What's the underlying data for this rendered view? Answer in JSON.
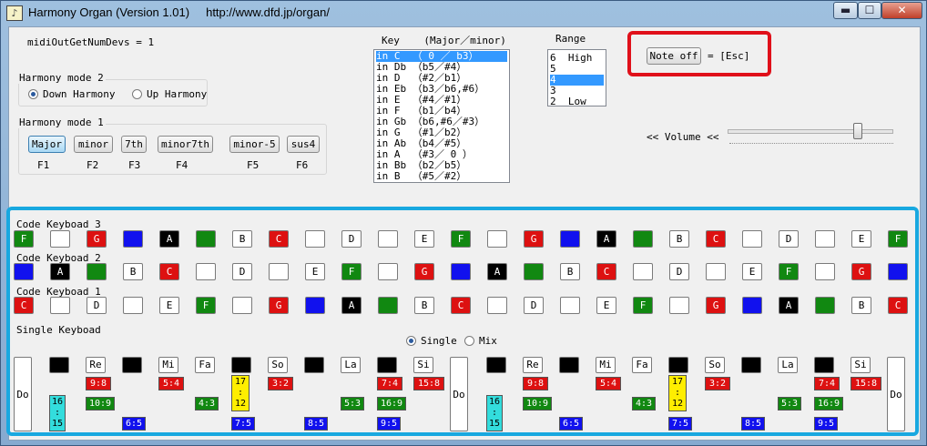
{
  "window": {
    "title": "Harmony Organ (Version 1.01)     http://www.dfd.jp/organ/",
    "min": "▬",
    "max": "☐",
    "close": "✕"
  },
  "midi_label": "midiOutGetNumDevs = 1",
  "harmony_mode2": {
    "title": "Harmony mode 2",
    "down": "Down Harmony",
    "up": "Up Harmony"
  },
  "harmony_mode1": {
    "title": "Harmony mode 1",
    "buttons": [
      "Major",
      "minor",
      "7th",
      "minor7th",
      "minor-5",
      "sus4"
    ],
    "fkeys": [
      "F1",
      "F2",
      "F3",
      "F4",
      "F5",
      "F6"
    ]
  },
  "key": {
    "title": "Key    (Major／minor)",
    "items": [
      "in C  （ 0 ／ b3）",
      "in Db （b5／#4）",
      "in D  （#2／b1）",
      "in Eb （b3／b6,#6）",
      "in E  （#4／#1）",
      "in F  （b1／b4）",
      "in Gb （b6,#6／#3）",
      "in G  （#1／b2）",
      "in Ab （b4／#5）",
      "in A  （#3／ 0 ）",
      "in Bb （b2／b5）",
      "in B  （#5／#2）"
    ]
  },
  "range": {
    "title": "Range",
    "items": [
      "6  High",
      "5",
      "4",
      "3",
      "2  Low"
    ]
  },
  "note_off": {
    "button": "Note off",
    "shortcut": "= [Esc]"
  },
  "volume": {
    "label": "<< Volume <<",
    "level": 0.8
  },
  "code_kb3": {
    "title": "Code Keyboad 3",
    "keys": [
      [
        "F",
        "g"
      ],
      [
        "",
        "w"
      ],
      [
        "G",
        "r"
      ],
      [
        "",
        "b"
      ],
      [
        "A",
        "bk"
      ],
      [
        "",
        "g"
      ],
      [
        "B",
        "w"
      ],
      [
        "C",
        "r"
      ],
      [
        "",
        "w"
      ],
      [
        "D",
        "w"
      ],
      [
        "",
        "w"
      ],
      [
        "E",
        "w"
      ],
      [
        "F",
        "g"
      ],
      [
        "",
        "w"
      ],
      [
        "G",
        "r"
      ],
      [
        "",
        "b"
      ],
      [
        "A",
        "bk"
      ],
      [
        "",
        "g"
      ],
      [
        "B",
        "w"
      ],
      [
        "C",
        "r"
      ],
      [
        "",
        "w"
      ],
      [
        "D",
        "w"
      ],
      [
        "",
        "w"
      ],
      [
        "E",
        "w"
      ],
      [
        "F",
        "g"
      ]
    ]
  },
  "code_kb2": {
    "title": "Code Keyboad 2",
    "keys": [
      [
        "",
        "b"
      ],
      [
        "A",
        "bk"
      ],
      [
        "",
        "g"
      ],
      [
        "B",
        "w"
      ],
      [
        "C",
        "r"
      ],
      [
        "",
        "w"
      ],
      [
        "D",
        "w"
      ],
      [
        "",
        "w"
      ],
      [
        "E",
        "w"
      ],
      [
        "F",
        "g"
      ],
      [
        "",
        "w"
      ],
      [
        "G",
        "r"
      ],
      [
        "",
        "b"
      ],
      [
        "A",
        "bk"
      ],
      [
        "",
        "g"
      ],
      [
        "B",
        "w"
      ],
      [
        "C",
        "r"
      ],
      [
        "",
        "w"
      ],
      [
        "D",
        "w"
      ],
      [
        "",
        "w"
      ],
      [
        "E",
        "w"
      ],
      [
        "F",
        "g"
      ],
      [
        "",
        "w"
      ],
      [
        "G",
        "r"
      ],
      [
        "",
        "b"
      ]
    ]
  },
  "code_kb1": {
    "title": "Code Keyboad 1",
    "keys": [
      [
        "C",
        "r"
      ],
      [
        "",
        "w"
      ],
      [
        "D",
        "w"
      ],
      [
        "",
        "w"
      ],
      [
        "E",
        "w"
      ],
      [
        "F",
        "g"
      ],
      [
        "",
        "w"
      ],
      [
        "G",
        "r"
      ],
      [
        "",
        "b"
      ],
      [
        "A",
        "bk"
      ],
      [
        "",
        "g"
      ],
      [
        "B",
        "w"
      ],
      [
        "C",
        "r"
      ],
      [
        "",
        "w"
      ],
      [
        "D",
        "w"
      ],
      [
        "",
        "w"
      ],
      [
        "E",
        "w"
      ],
      [
        "F",
        "g"
      ],
      [
        "",
        "w"
      ],
      [
        "G",
        "r"
      ],
      [
        "",
        "b"
      ],
      [
        "A",
        "bk"
      ],
      [
        "",
        "g"
      ],
      [
        "B",
        "w"
      ],
      [
        "C",
        "r"
      ]
    ]
  },
  "single_kb": {
    "title": "Single Keyboad",
    "single": "Single",
    "mix": "Mix",
    "do": "Do",
    "whites": [
      "Re",
      "Mi",
      "Fa",
      "So",
      "La",
      "Si"
    ],
    "ratios": {
      "r98": "9:8",
      "r109": "10:9",
      "r54": "5:4",
      "r43": "4:3",
      "r32": "3:2",
      "r53": "5:3",
      "r74": "7:4",
      "r169": "16:9",
      "r158": "15:8",
      "r1615": "16\n:\n15",
      "r65": "6:5",
      "r1712": "17\n:\n12",
      "r75": "7:5",
      "r85": "8:5",
      "r95": "9:5"
    }
  }
}
